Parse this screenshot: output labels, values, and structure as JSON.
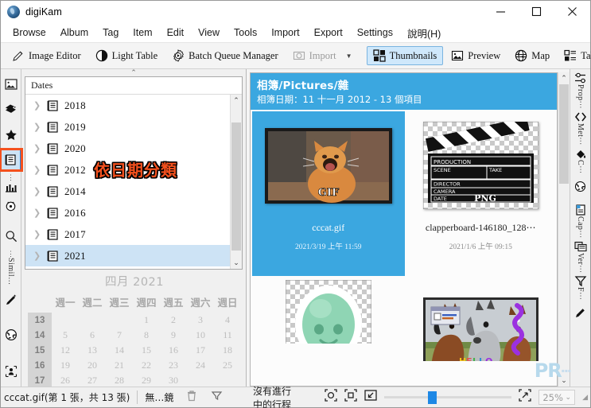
{
  "window": {
    "title": "digiKam",
    "app_icon": "digikam-logo-icon",
    "controls": {
      "minimize": "minimize-icon",
      "maximize": "maximize-icon",
      "close": "close-icon"
    }
  },
  "menubar": {
    "items": [
      {
        "label": "Browse"
      },
      {
        "label": "Album"
      },
      {
        "label": "Tag"
      },
      {
        "label": "Item"
      },
      {
        "label": "Edit"
      },
      {
        "label": "View"
      },
      {
        "label": "Tools"
      },
      {
        "label": "Import"
      },
      {
        "label": "Export"
      },
      {
        "label": "Settings"
      },
      {
        "label": "說明(H)"
      }
    ]
  },
  "toolbar": {
    "buttons": [
      {
        "label": "Image Editor",
        "icon": "pencil-icon",
        "state": "normal"
      },
      {
        "label": "Light Table",
        "icon": "half-circle-icon",
        "state": "normal"
      },
      {
        "label": "Batch Queue Manager",
        "icon": "gear-play-icon",
        "state": "normal"
      },
      {
        "label": "Import",
        "icon": "camera-icon",
        "state": "disabled"
      }
    ],
    "dropdown_caret": "chevron-down-icon",
    "views": [
      {
        "label": "Thumbnails",
        "icon": "grid-icon",
        "state": "active"
      },
      {
        "label": "Preview",
        "icon": "picture-icon",
        "state": "normal"
      },
      {
        "label": "Map",
        "icon": "globe-icon",
        "state": "normal"
      },
      {
        "label": "Table",
        "icon": "table-icon",
        "state": "normal"
      }
    ],
    "overflow": "»"
  },
  "left_rail": {
    "items": [
      {
        "name": "albums",
        "icon": "album-picture-icon",
        "selected": false
      },
      {
        "name": "tags",
        "icon": "tag-icon",
        "selected": false
      },
      {
        "name": "labels",
        "icon": "star-icon",
        "selected": false
      },
      {
        "name": "dates",
        "icon": "dates-list-icon",
        "selected": true
      },
      {
        "name": "timeline",
        "icon": "timeline-icon",
        "label": "",
        "selected": false
      },
      {
        "name": "search",
        "icon": "search-icon",
        "selected": false
      },
      {
        "name": "similarity",
        "icon": "similarity-icon",
        "label": "Simil…",
        "selected": false
      },
      {
        "name": "map",
        "icon": "globe-icon",
        "selected": false
      },
      {
        "name": "people",
        "icon": "people-icon",
        "selected": false
      }
    ]
  },
  "left_panel": {
    "dates_header": "Dates",
    "tree": [
      {
        "label": "2018",
        "selected": false
      },
      {
        "label": "2019",
        "selected": false
      },
      {
        "label": "2020",
        "selected": false
      },
      {
        "label": "2012",
        "selected": false
      },
      {
        "label": "2014",
        "selected": false
      },
      {
        "label": "2016",
        "selected": false
      },
      {
        "label": "2017",
        "selected": false
      },
      {
        "label": "2021",
        "selected": true
      }
    ],
    "annotation": "依日期分類",
    "annotation_color": "#f4511e",
    "calendar": {
      "title": "四月 2021",
      "weekday_headers": [
        "週一",
        "週二",
        "週三",
        "週四",
        "週五",
        "週六",
        "週日"
      ],
      "weeks": [
        {
          "week": "13",
          "days": [
            "",
            "",
            "",
            "1",
            "2",
            "3",
            "4"
          ]
        },
        {
          "week": "14",
          "days": [
            "5",
            "6",
            "7",
            "8",
            "9",
            "10",
            "11"
          ]
        },
        {
          "week": "15",
          "days": [
            "12",
            "13",
            "14",
            "15",
            "16",
            "17",
            "18"
          ]
        },
        {
          "week": "16",
          "days": [
            "19",
            "20",
            "21",
            "22",
            "23",
            "24",
            "25"
          ]
        },
        {
          "week": "17",
          "days": [
            "26",
            "27",
            "28",
            "29",
            "30",
            "",
            ""
          ]
        }
      ]
    }
  },
  "main": {
    "album_banner": {
      "title": "相簿/Pictures/雜",
      "subtitle": "相簿日期：11 十一月 2012 - 13 個項目",
      "background": "#3ba7e0"
    },
    "items": [
      {
        "name": "cccat.gif",
        "caption": "cccat.gif",
        "date": "2021/3/19 上午 11:59",
        "selected": true,
        "thumb": "cat-gif-thumb"
      },
      {
        "name": "clapperboard",
        "caption": "clapperboard-146180_128⋯",
        "date": "2021/1/6 上午 09:15",
        "selected": false,
        "thumb": "clapperboard-png-thumb"
      },
      {
        "name": "green-figure",
        "caption": "",
        "date": "",
        "selected": false,
        "thumb": "green-figure-thumb"
      },
      {
        "name": "horses",
        "caption": "",
        "date": "",
        "selected": false,
        "thumb": "horses-hello-thumb"
      }
    ],
    "watermark": "PR"
  },
  "right_rail": {
    "items": [
      {
        "icon": "properties-icon",
        "label": "Prop⋯"
      },
      {
        "icon": "metadata-icon",
        "label": "Met⋯"
      },
      {
        "icon": "colors-icon",
        "label": "C⋯"
      },
      {
        "icon": "globe-icon",
        "label": ""
      },
      {
        "icon": "caption-icon",
        "label": "Cap⋯"
      },
      {
        "icon": "versions-icon",
        "label": "Ver⋯"
      },
      {
        "icon": "filters-icon",
        "label": "F⋯"
      },
      {
        "icon": "pencil-icon",
        "label": ""
      }
    ]
  },
  "statusbar": {
    "file_info": "cccat.gif(第 1 張，共 13 張)",
    "lens_info": "無…鏡",
    "trash_icon": "trash-icon",
    "filter_icon": "funnel-icon",
    "progress_text": "沒有進行中的行程",
    "fit_icons": [
      "fit-selection-icon",
      "fit-window-icon",
      "zoom-out-icon"
    ],
    "zoom_expand_icon": "zoom-fit-icon",
    "zoom_value": "25%",
    "zoom_caret": "chevron-down-icon",
    "zoom_slider_percent": 34
  }
}
